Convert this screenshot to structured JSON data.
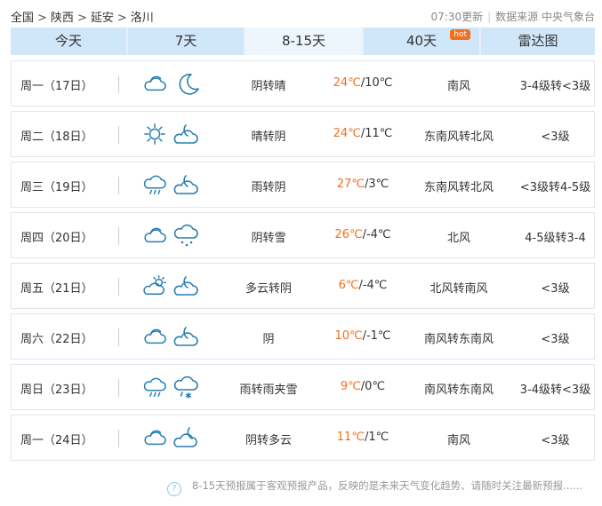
{
  "breadcrumb": [
    "全国",
    "陕西",
    "延安",
    "洛川"
  ],
  "breadcrumb_sep": ">",
  "update_time": "07:30更新",
  "source": "数据来源 中央气象台",
  "tabs": [
    {
      "label": "今天",
      "active": false
    },
    {
      "label": "7天",
      "active": false
    },
    {
      "label": "8-15天",
      "active": true
    },
    {
      "label": "40天",
      "active": false,
      "badge": "hot"
    },
    {
      "label": "雷达图",
      "active": false
    }
  ],
  "days": [
    {
      "day": "周一（17日）",
      "icon_day": "cloudy-icon",
      "icon_night": "moon-icon",
      "cond": "阴转晴",
      "hi": "24℃",
      "lo": "/10℃",
      "wind_dir": "南风",
      "wind_lvl": "3-4级转<3级"
    },
    {
      "day": "周二（18日）",
      "icon_day": "sun-icon",
      "icon_night": "cloudy-night-icon",
      "cond": "晴转阴",
      "hi": "24℃",
      "lo": "/11℃",
      "wind_dir": "东南风转北风",
      "wind_lvl": "<3级"
    },
    {
      "day": "周三（19日）",
      "icon_day": "rain-icon",
      "icon_night": "cloudy-night-icon",
      "cond": "雨转阴",
      "hi": "27℃",
      "lo": "/3℃",
      "wind_dir": "东南风转北风",
      "wind_lvl": "<3级转4-5级"
    },
    {
      "day": "周四（20日）",
      "icon_day": "cloudy-icon",
      "icon_night": "snow-icon",
      "cond": "阴转雪",
      "hi": "26℃",
      "lo": "/-4℃",
      "wind_dir": "北风",
      "wind_lvl": "4-5级转3-4"
    },
    {
      "day": "周五（21日）",
      "icon_day": "partly-cloudy-icon",
      "icon_night": "cloudy-night-icon",
      "cond": "多云转阴",
      "hi": "6℃",
      "lo": "/-4℃",
      "wind_dir": "北风转南风",
      "wind_lvl": "<3级"
    },
    {
      "day": "周六（22日）",
      "icon_day": "cloudy-icon",
      "icon_night": "cloudy-night-icon",
      "cond": "阴",
      "hi": "10℃",
      "lo": "/-1℃",
      "wind_dir": "南风转东南风",
      "wind_lvl": "<3级"
    },
    {
      "day": "周日（23日）",
      "icon_day": "rain-icon",
      "icon_night": "sleet-icon",
      "cond": "雨转雨夹雪",
      "hi": "9℃",
      "lo": "/0℃",
      "wind_dir": "南风转东南风",
      "wind_lvl": "3-4级转<3级"
    },
    {
      "day": "周一（24日）",
      "icon_day": "cloudy-icon",
      "icon_night": "partly-cloudy-night-icon",
      "cond": "阴转多云",
      "hi": "11℃",
      "lo": "/1℃",
      "wind_dir": "南风",
      "wind_lvl": "<3级"
    }
  ],
  "footer_text": "8-15天预报属于客观预报产品，反映的是未来天气变化趋势、请随时关注最新预报......",
  "colors": {
    "accent": "#f36f21",
    "tab_bg": "#d0e6f9",
    "tab_active": "#eef6fd",
    "icon": "#2a7fb0"
  }
}
